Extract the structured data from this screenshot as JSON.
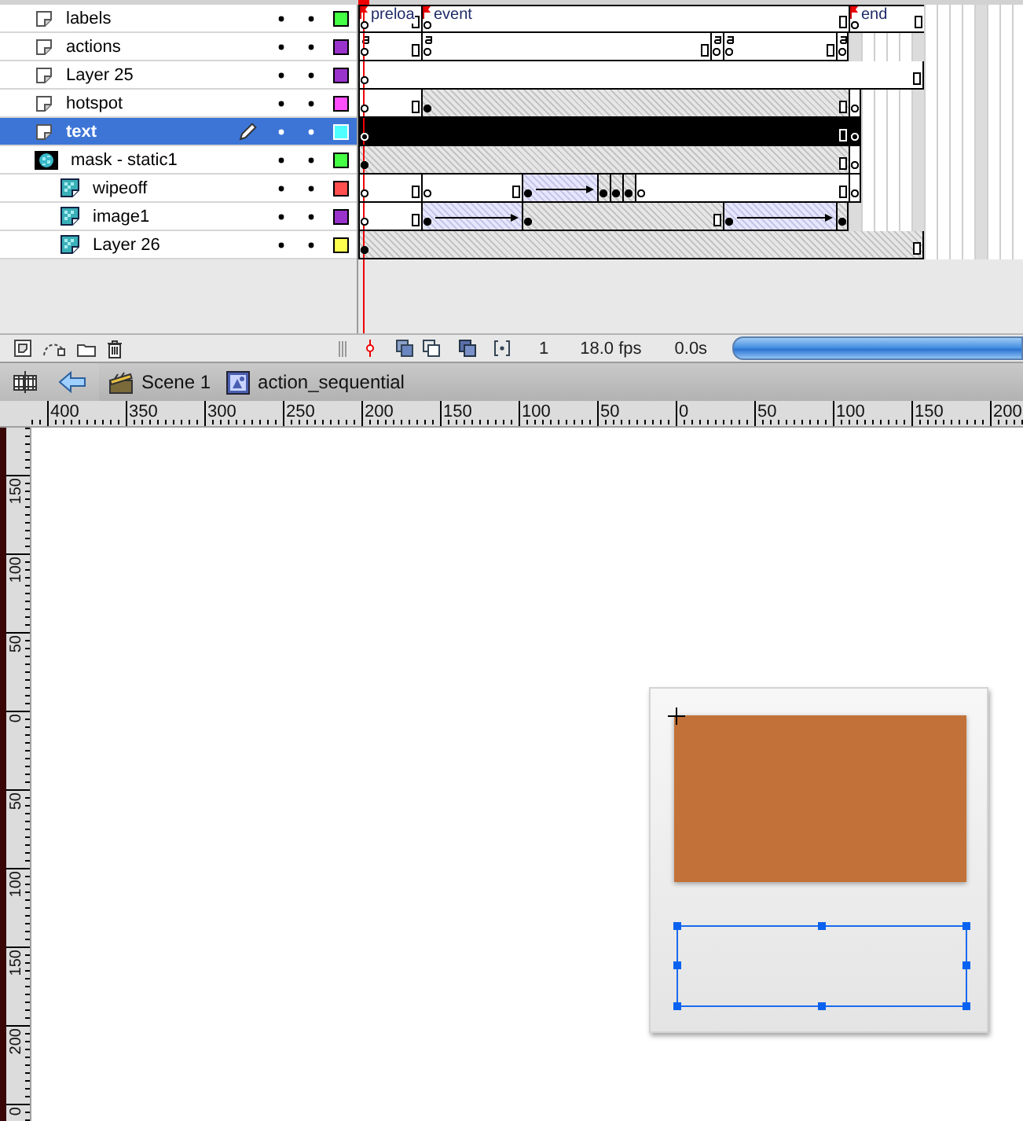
{
  "layers": [
    {
      "name": "labels",
      "kind": "normal",
      "selected": false,
      "editing": false,
      "hidden": false,
      "locked": false,
      "color": "#44ff44",
      "frames": [
        {
          "kind": "blank",
          "filled": false,
          "label": "preloa",
          "cells": [
            {
              "kind": "key"
            },
            {
              "kind": "frame"
            },
            {
              "kind": "frame"
            },
            {
              "kind": "frame"
            },
            {
              "kind": "end"
            }
          ]
        },
        {
          "kind": "blank",
          "filled": false,
          "label": "event",
          "cells": [
            {
              "kind": "key"
            },
            {
              "kind": "frame"
            },
            {
              "kind": "frame"
            },
            {
              "kind": "frame"
            },
            {
              "kind": "frame"
            },
            {
              "kind": "frame"
            },
            {
              "kind": "frame"
            },
            {
              "kind": "frame"
            },
            {
              "kind": "frame"
            },
            {
              "kind": "frame"
            },
            {
              "kind": "frame"
            },
            {
              "kind": "frame"
            },
            {
              "kind": "frame"
            },
            {
              "kind": "frame"
            },
            {
              "kind": "frame"
            },
            {
              "kind": "frame"
            },
            {
              "kind": "frame"
            },
            {
              "kind": "frame"
            },
            {
              "kind": "frame"
            },
            {
              "kind": "frame"
            },
            {
              "kind": "frame"
            },
            {
              "kind": "frame"
            },
            {
              "kind": "frame"
            },
            {
              "kind": "frame"
            },
            {
              "kind": "frame"
            },
            {
              "kind": "frame"
            },
            {
              "kind": "frame"
            },
            {
              "kind": "frame"
            },
            {
              "kind": "frame"
            },
            {
              "kind": "frame"
            },
            {
              "kind": "frame"
            },
            {
              "kind": "frame"
            },
            {
              "kind": "frame"
            },
            {
              "kind": "end"
            }
          ]
        },
        {
          "kind": "blank",
          "filled": false,
          "label": "end",
          "cells": [
            {
              "kind": "key"
            },
            {
              "kind": "frame"
            },
            {
              "kind": "frame"
            },
            {
              "kind": "frame"
            },
            {
              "kind": "frame"
            },
            {
              "kind": "end"
            }
          ]
        }
      ]
    },
    {
      "name": "actions",
      "kind": "normal",
      "selected": false,
      "editing": false,
      "hidden": false,
      "locked": false,
      "color": "#9933cc",
      "frames": [
        {
          "kind": "blank",
          "filled": false,
          "action": true,
          "cells": [
            {
              "kind": "key"
            },
            {
              "kind": "frame"
            },
            {
              "kind": "frame"
            },
            {
              "kind": "frame"
            },
            {
              "kind": "end"
            }
          ]
        },
        {
          "kind": "blank",
          "filled": false,
          "action": true,
          "cells": [
            {
              "kind": "key"
            },
            {
              "kind": "frame"
            },
            {
              "kind": "frame"
            },
            {
              "kind": "frame"
            },
            {
              "kind": "frame"
            },
            {
              "kind": "frame"
            },
            {
              "kind": "frame"
            },
            {
              "kind": "frame"
            },
            {
              "kind": "frame"
            },
            {
              "kind": "frame"
            },
            {
              "kind": "frame"
            },
            {
              "kind": "frame"
            },
            {
              "kind": "frame"
            },
            {
              "kind": "frame"
            },
            {
              "kind": "frame"
            },
            {
              "kind": "frame"
            },
            {
              "kind": "frame"
            },
            {
              "kind": "frame"
            },
            {
              "kind": "frame"
            },
            {
              "kind": "frame"
            },
            {
              "kind": "frame"
            },
            {
              "kind": "frame"
            },
            {
              "kind": "end"
            }
          ]
        },
        {
          "kind": "blank",
          "filled": false,
          "action": true,
          "cells": [
            {
              "kind": "key"
            }
          ]
        },
        {
          "kind": "blank",
          "filled": false,
          "action": true,
          "cells": [
            {
              "kind": "key"
            },
            {
              "kind": "frame"
            },
            {
              "kind": "frame"
            },
            {
              "kind": "frame"
            },
            {
              "kind": "frame"
            },
            {
              "kind": "frame"
            },
            {
              "kind": "frame"
            },
            {
              "kind": "frame"
            },
            {
              "kind": "end"
            }
          ]
        },
        {
          "kind": "blank",
          "filled": false,
          "action": true,
          "cells": [
            {
              "kind": "key"
            }
          ]
        }
      ]
    },
    {
      "name": "Layer 25",
      "kind": "normal",
      "selected": false,
      "editing": false,
      "hidden": false,
      "locked": false,
      "color": "#9933cc",
      "frames": [
        {
          "kind": "blank",
          "filled": false,
          "cells": [
            {
              "kind": "key"
            },
            {
              "kind": "frame"
            },
            {
              "kind": "frame"
            },
            {
              "kind": "frame"
            },
            {
              "kind": "frame"
            },
            {
              "kind": "frame"
            },
            {
              "kind": "frame"
            },
            {
              "kind": "frame"
            },
            {
              "kind": "frame"
            },
            {
              "kind": "frame"
            },
            {
              "kind": "frame"
            },
            {
              "kind": "frame"
            },
            {
              "kind": "frame"
            },
            {
              "kind": "frame"
            },
            {
              "kind": "frame"
            },
            {
              "kind": "frame"
            },
            {
              "kind": "frame"
            },
            {
              "kind": "frame"
            },
            {
              "kind": "frame"
            },
            {
              "kind": "frame"
            },
            {
              "kind": "frame"
            },
            {
              "kind": "frame"
            },
            {
              "kind": "frame"
            },
            {
              "kind": "frame"
            },
            {
              "kind": "frame"
            },
            {
              "kind": "frame"
            },
            {
              "kind": "frame"
            },
            {
              "kind": "frame"
            },
            {
              "kind": "frame"
            },
            {
              "kind": "frame"
            },
            {
              "kind": "frame"
            },
            {
              "kind": "frame"
            },
            {
              "kind": "frame"
            },
            {
              "kind": "frame"
            },
            {
              "kind": "frame"
            },
            {
              "kind": "frame"
            },
            {
              "kind": "frame"
            },
            {
              "kind": "frame"
            },
            {
              "kind": "frame"
            },
            {
              "kind": "frame"
            },
            {
              "kind": "frame"
            },
            {
              "kind": "frame"
            },
            {
              "kind": "frame"
            },
            {
              "kind": "frame"
            },
            {
              "kind": "end"
            }
          ]
        }
      ]
    },
    {
      "name": "hotspot",
      "kind": "normal",
      "selected": false,
      "editing": false,
      "hidden": false,
      "locked": false,
      "color": "#ff4fff",
      "frames": [
        {
          "kind": "blank",
          "filled": false,
          "cells": [
            {
              "kind": "key"
            },
            {
              "kind": "frame"
            },
            {
              "kind": "frame"
            },
            {
              "kind": "frame"
            },
            {
              "kind": "end"
            }
          ]
        },
        {
          "kind": "content",
          "filled": true,
          "cells": [
            {
              "kind": "key"
            },
            {
              "kind": "frame"
            },
            {
              "kind": "frame"
            },
            {
              "kind": "frame"
            },
            {
              "kind": "frame"
            },
            {
              "kind": "frame"
            },
            {
              "kind": "frame"
            },
            {
              "kind": "frame"
            },
            {
              "kind": "frame"
            },
            {
              "kind": "frame"
            },
            {
              "kind": "frame"
            },
            {
              "kind": "frame"
            },
            {
              "kind": "frame"
            },
            {
              "kind": "frame"
            },
            {
              "kind": "frame"
            },
            {
              "kind": "frame"
            },
            {
              "kind": "frame"
            },
            {
              "kind": "frame"
            },
            {
              "kind": "frame"
            },
            {
              "kind": "frame"
            },
            {
              "kind": "frame"
            },
            {
              "kind": "frame"
            },
            {
              "kind": "frame"
            },
            {
              "kind": "frame"
            },
            {
              "kind": "frame"
            },
            {
              "kind": "frame"
            },
            {
              "kind": "frame"
            },
            {
              "kind": "frame"
            },
            {
              "kind": "frame"
            },
            {
              "kind": "frame"
            },
            {
              "kind": "frame"
            },
            {
              "kind": "frame"
            },
            {
              "kind": "frame"
            },
            {
              "kind": "end"
            }
          ]
        },
        {
          "kind": "blank",
          "filled": false,
          "cells": [
            {
              "kind": "key"
            }
          ]
        }
      ]
    },
    {
      "name": "text",
      "kind": "normal",
      "selected": true,
      "editing": true,
      "hidden": false,
      "locked": false,
      "color": "#4fffff",
      "frames": [
        {
          "kind": "content",
          "filled": false,
          "cells": [
            {
              "kind": "key"
            },
            {
              "kind": "frame"
            },
            {
              "kind": "frame"
            },
            {
              "kind": "frame"
            },
            {
              "kind": "frame"
            },
            {
              "kind": "frame"
            },
            {
              "kind": "frame"
            },
            {
              "kind": "frame"
            },
            {
              "kind": "frame"
            },
            {
              "kind": "frame"
            },
            {
              "kind": "frame"
            },
            {
              "kind": "frame"
            },
            {
              "kind": "frame"
            },
            {
              "kind": "frame"
            },
            {
              "kind": "frame"
            },
            {
              "kind": "frame"
            },
            {
              "kind": "frame"
            },
            {
              "kind": "frame"
            },
            {
              "kind": "frame"
            },
            {
              "kind": "frame"
            },
            {
              "kind": "frame"
            },
            {
              "kind": "frame"
            },
            {
              "kind": "frame"
            },
            {
              "kind": "frame"
            },
            {
              "kind": "frame"
            },
            {
              "kind": "frame"
            },
            {
              "kind": "frame"
            },
            {
              "kind": "frame"
            },
            {
              "kind": "frame"
            },
            {
              "kind": "frame"
            },
            {
              "kind": "frame"
            },
            {
              "kind": "frame"
            },
            {
              "kind": "frame"
            },
            {
              "kind": "frame"
            },
            {
              "kind": "frame"
            },
            {
              "kind": "frame"
            },
            {
              "kind": "frame"
            },
            {
              "kind": "frame"
            },
            {
              "kind": "end"
            }
          ]
        },
        {
          "kind": "blank",
          "filled": false,
          "cells": [
            {
              "kind": "key"
            }
          ]
        }
      ]
    },
    {
      "name": "mask - static1",
      "kind": "mask",
      "selected": false,
      "editing": false,
      "hidden": false,
      "locked": false,
      "color": "#44ff44",
      "frames": [
        {
          "kind": "content",
          "filled": true,
          "cells": [
            {
              "kind": "key"
            },
            {
              "kind": "frame"
            },
            {
              "kind": "frame"
            },
            {
              "kind": "frame"
            },
            {
              "kind": "frame"
            },
            {
              "kind": "frame"
            },
            {
              "kind": "frame"
            },
            {
              "kind": "frame"
            },
            {
              "kind": "frame"
            },
            {
              "kind": "frame"
            },
            {
              "kind": "frame"
            },
            {
              "kind": "frame"
            },
            {
              "kind": "frame"
            },
            {
              "kind": "frame"
            },
            {
              "kind": "frame"
            },
            {
              "kind": "frame"
            },
            {
              "kind": "frame"
            },
            {
              "kind": "frame"
            },
            {
              "kind": "frame"
            },
            {
              "kind": "frame"
            },
            {
              "kind": "frame"
            },
            {
              "kind": "frame"
            },
            {
              "kind": "frame"
            },
            {
              "kind": "frame"
            },
            {
              "kind": "frame"
            },
            {
              "kind": "frame"
            },
            {
              "kind": "frame"
            },
            {
              "kind": "frame"
            },
            {
              "kind": "frame"
            },
            {
              "kind": "frame"
            },
            {
              "kind": "frame"
            },
            {
              "kind": "frame"
            },
            {
              "kind": "frame"
            },
            {
              "kind": "frame"
            },
            {
              "kind": "frame"
            },
            {
              "kind": "frame"
            },
            {
              "kind": "frame"
            },
            {
              "kind": "frame"
            },
            {
              "kind": "end"
            }
          ]
        },
        {
          "kind": "blank",
          "filled": false,
          "cells": [
            {
              "kind": "key"
            }
          ]
        }
      ],
      "children": [
        {
          "name": "wipeoff",
          "kind": "masked",
          "selected": false,
          "editing": false,
          "hidden": false,
          "locked": false,
          "color": "#ff4f4f",
          "frames": [
            {
              "kind": "blank",
              "filled": false,
              "cells": [
                {
                  "kind": "key"
                },
                {
                  "kind": "frame"
                },
                {
                  "kind": "frame"
                },
                {
                  "kind": "frame"
                },
                {
                  "kind": "end"
                }
              ]
            },
            {
              "kind": "blank",
              "filled": false,
              "cells": [
                {
                  "kind": "key"
                },
                {
                  "kind": "frame"
                },
                {
                  "kind": "frame"
                },
                {
                  "kind": "frame"
                },
                {
                  "kind": "frame"
                },
                {
                  "kind": "frame"
                },
                {
                  "kind": "frame"
                },
                {
                  "kind": "end"
                }
              ]
            },
            {
              "kind": "tween",
              "filled": true,
              "cells": [
                {
                  "kind": "key"
                },
                {
                  "kind": "frame"
                },
                {
                  "kind": "frame"
                },
                {
                  "kind": "frame"
                },
                {
                  "kind": "frame"
                },
                {
                  "kind": "frame"
                }
              ]
            },
            {
              "kind": "content",
              "filled": true,
              "cells": [
                {
                  "kind": "key"
                }
              ]
            },
            {
              "kind": "content",
              "filled": true,
              "cells": [
                {
                  "kind": "key"
                }
              ]
            },
            {
              "kind": "content",
              "filled": true,
              "cells": [
                {
                  "kind": "key"
                }
              ]
            },
            {
              "kind": "blank",
              "filled": false,
              "cells": [
                {
                  "kind": "key"
                },
                {
                  "kind": "frame"
                },
                {
                  "kind": "frame"
                },
                {
                  "kind": "frame"
                },
                {
                  "kind": "frame"
                },
                {
                  "kind": "frame"
                },
                {
                  "kind": "frame"
                },
                {
                  "kind": "frame"
                },
                {
                  "kind": "frame"
                },
                {
                  "kind": "frame"
                },
                {
                  "kind": "frame"
                },
                {
                  "kind": "frame"
                },
                {
                  "kind": "frame"
                },
                {
                  "kind": "frame"
                },
                {
                  "kind": "frame"
                },
                {
                  "kind": "frame"
                },
                {
                  "kind": "end"
                }
              ]
            },
            {
              "kind": "blank",
              "filled": false,
              "cells": [
                {
                  "kind": "key"
                }
              ]
            }
          ]
        },
        {
          "name": "image1",
          "kind": "masked",
          "selected": false,
          "editing": false,
          "hidden": false,
          "locked": false,
          "color": "#9933cc",
          "frames": [
            {
              "kind": "blank",
              "filled": false,
              "cells": [
                {
                  "kind": "key"
                },
                {
                  "kind": "frame"
                },
                {
                  "kind": "frame"
                },
                {
                  "kind": "frame"
                },
                {
                  "kind": "end"
                }
              ]
            },
            {
              "kind": "tween",
              "filled": true,
              "cells": [
                {
                  "kind": "key"
                },
                {
                  "kind": "frame"
                },
                {
                  "kind": "frame"
                },
                {
                  "kind": "frame"
                },
                {
                  "kind": "frame"
                },
                {
                  "kind": "frame"
                },
                {
                  "kind": "frame"
                },
                {
                  "kind": "frame"
                }
              ]
            },
            {
              "kind": "content",
              "filled": true,
              "cells": [
                {
                  "kind": "key"
                },
                {
                  "kind": "frame"
                },
                {
                  "kind": "frame"
                },
                {
                  "kind": "frame"
                },
                {
                  "kind": "frame"
                },
                {
                  "kind": "frame"
                },
                {
                  "kind": "frame"
                },
                {
                  "kind": "frame"
                },
                {
                  "kind": "frame"
                },
                {
                  "kind": "frame"
                },
                {
                  "kind": "frame"
                },
                {
                  "kind": "frame"
                },
                {
                  "kind": "frame"
                },
                {
                  "kind": "frame"
                },
                {
                  "kind": "frame"
                },
                {
                  "kind": "end"
                }
              ]
            },
            {
              "kind": "tween",
              "filled": true,
              "cells": [
                {
                  "kind": "key"
                },
                {
                  "kind": "frame"
                },
                {
                  "kind": "frame"
                },
                {
                  "kind": "frame"
                },
                {
                  "kind": "frame"
                },
                {
                  "kind": "frame"
                },
                {
                  "kind": "frame"
                },
                {
                  "kind": "frame"
                },
                {
                  "kind": "frame"
                }
              ]
            },
            {
              "kind": "content",
              "filled": true,
              "cells": [
                {
                  "kind": "key"
                }
              ]
            }
          ]
        },
        {
          "name": "Layer 26",
          "kind": "masked",
          "selected": false,
          "editing": false,
          "hidden": false,
          "locked": false,
          "color": "#ffff4f",
          "frames": [
            {
              "kind": "content",
              "filled": true,
              "cells": [
                {
                  "kind": "key"
                },
                {
                  "kind": "frame"
                },
                {
                  "kind": "frame"
                },
                {
                  "kind": "frame"
                },
                {
                  "kind": "frame"
                },
                {
                  "kind": "frame"
                },
                {
                  "kind": "frame"
                },
                {
                  "kind": "frame"
                },
                {
                  "kind": "frame"
                },
                {
                  "kind": "frame"
                },
                {
                  "kind": "frame"
                },
                {
                  "kind": "frame"
                },
                {
                  "kind": "frame"
                },
                {
                  "kind": "frame"
                },
                {
                  "kind": "frame"
                },
                {
                  "kind": "frame"
                },
                {
                  "kind": "frame"
                },
                {
                  "kind": "frame"
                },
                {
                  "kind": "frame"
                },
                {
                  "kind": "frame"
                },
                {
                  "kind": "frame"
                },
                {
                  "kind": "frame"
                },
                {
                  "kind": "frame"
                },
                {
                  "kind": "frame"
                },
                {
                  "kind": "frame"
                },
                {
                  "kind": "frame"
                },
                {
                  "kind": "frame"
                },
                {
                  "kind": "frame"
                },
                {
                  "kind": "frame"
                },
                {
                  "kind": "frame"
                },
                {
                  "kind": "frame"
                },
                {
                  "kind": "frame"
                },
                {
                  "kind": "frame"
                },
                {
                  "kind": "frame"
                },
                {
                  "kind": "frame"
                },
                {
                  "kind": "frame"
                },
                {
                  "kind": "frame"
                },
                {
                  "kind": "frame"
                },
                {
                  "kind": "frame"
                },
                {
                  "kind": "frame"
                },
                {
                  "kind": "frame"
                },
                {
                  "kind": "frame"
                },
                {
                  "kind": "frame"
                },
                {
                  "kind": "frame"
                },
                {
                  "kind": "end"
                }
              ]
            }
          ]
        }
      ]
    }
  ],
  "timeline_footer": {
    "current_frame": "1",
    "frame_rate": "18.0 fps",
    "elapsed": "0.0s"
  },
  "edit_bar": {
    "breadcrumbs": [
      {
        "kind": "scene",
        "label": "Scene 1"
      },
      {
        "kind": "symbol",
        "label": "action_sequential"
      }
    ]
  },
  "rulers": {
    "horizontal": [
      "400",
      "350",
      "300",
      "250",
      "200",
      "150",
      "100",
      "50",
      "0",
      "50",
      "100",
      "150",
      "200"
    ],
    "vertical": [
      "150",
      "100",
      "50",
      "0",
      "50",
      "100",
      "150",
      "200",
      "0"
    ]
  }
}
